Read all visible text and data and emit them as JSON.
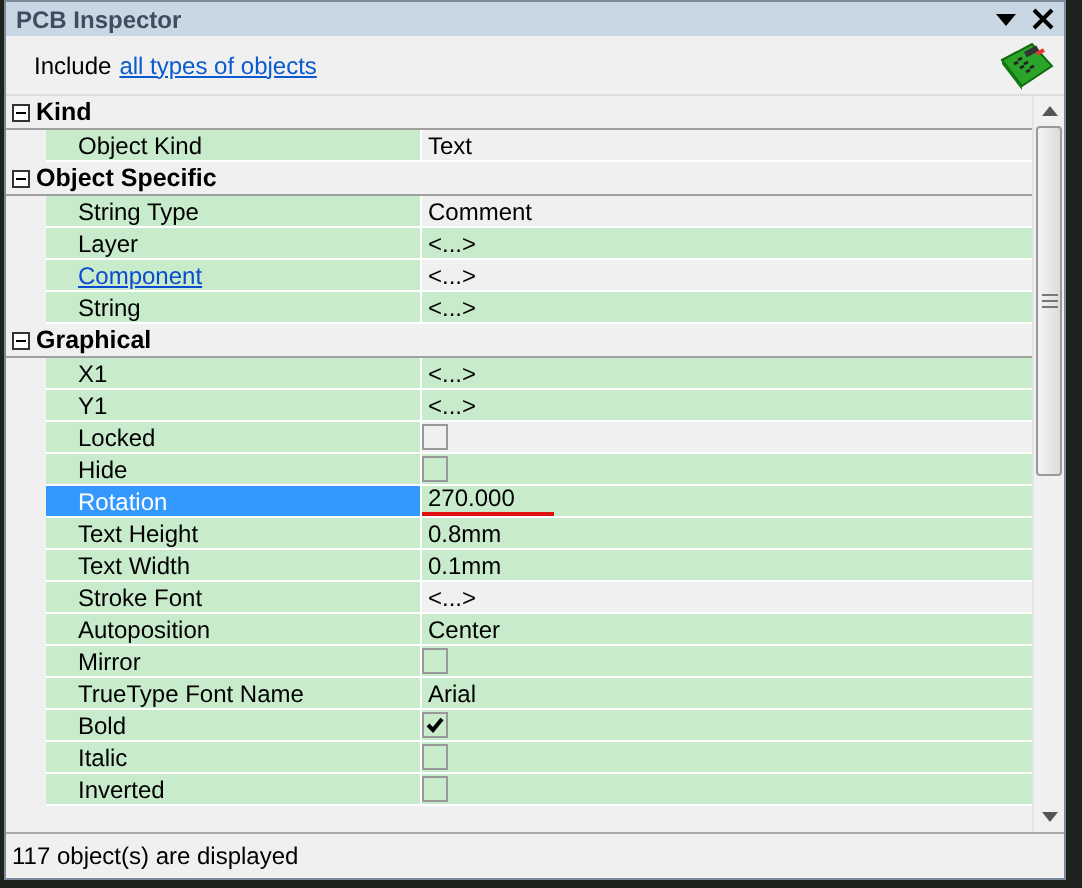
{
  "window": {
    "title": "PCB Inspector"
  },
  "filter": {
    "prefix": "Include",
    "link": "all types of objects"
  },
  "categories": [
    {
      "title": "Kind",
      "expanded": true,
      "rows": [
        {
          "name": "Object Kind",
          "kind": "text",
          "value": "Text",
          "read_only": true,
          "selected": false,
          "link": false
        }
      ]
    },
    {
      "title": "Object Specific",
      "expanded": true,
      "rows": [
        {
          "name": "String Type",
          "kind": "text",
          "value": "Comment",
          "read_only": true,
          "selected": false,
          "link": false
        },
        {
          "name": "Layer",
          "kind": "text",
          "value": "<...>",
          "read_only": false,
          "selected": false,
          "link": false
        },
        {
          "name": "Component",
          "kind": "text",
          "value": "<...>",
          "read_only": true,
          "selected": false,
          "link": true
        },
        {
          "name": "String",
          "kind": "text",
          "value": "<...>",
          "read_only": false,
          "selected": false,
          "link": false
        }
      ]
    },
    {
      "title": "Graphical",
      "expanded": true,
      "rows": [
        {
          "name": "X1",
          "kind": "text",
          "value": "<...>",
          "read_only": false,
          "selected": false,
          "link": false
        },
        {
          "name": "Y1",
          "kind": "text",
          "value": "<...>",
          "read_only": false,
          "selected": false,
          "link": false
        },
        {
          "name": "Locked",
          "kind": "checkbox",
          "checked": false,
          "read_only": true,
          "selected": false,
          "link": false
        },
        {
          "name": "Hide",
          "kind": "checkbox",
          "checked": false,
          "read_only": false,
          "selected": false,
          "link": false
        },
        {
          "name": "Rotation",
          "kind": "text",
          "value": "270.000",
          "read_only": false,
          "selected": true,
          "link": false
        },
        {
          "name": "Text Height",
          "kind": "text",
          "value": "0.8mm",
          "read_only": false,
          "selected": false,
          "link": false
        },
        {
          "name": "Text Width",
          "kind": "text",
          "value": "0.1mm",
          "read_only": false,
          "selected": false,
          "link": false
        },
        {
          "name": "Stroke Font",
          "kind": "text",
          "value": "<...>",
          "read_only": true,
          "selected": false,
          "link": false
        },
        {
          "name": "Autoposition",
          "kind": "text",
          "value": "Center",
          "read_only": false,
          "selected": false,
          "link": false
        },
        {
          "name": "Mirror",
          "kind": "checkbox",
          "checked": false,
          "read_only": false,
          "selected": false,
          "link": false
        },
        {
          "name": "TrueType Font Name",
          "kind": "text",
          "value": "Arial",
          "read_only": false,
          "selected": false,
          "link": false
        },
        {
          "name": "Bold",
          "kind": "checkbox",
          "checked": true,
          "read_only": false,
          "selected": false,
          "link": false
        },
        {
          "name": "Italic",
          "kind": "checkbox",
          "checked": false,
          "read_only": false,
          "selected": false,
          "link": false
        },
        {
          "name": "Inverted",
          "kind": "checkbox",
          "checked": false,
          "read_only": false,
          "selected": false,
          "link": false
        }
      ]
    }
  ],
  "status_bar": {
    "text": "117 object(s) are displayed"
  }
}
